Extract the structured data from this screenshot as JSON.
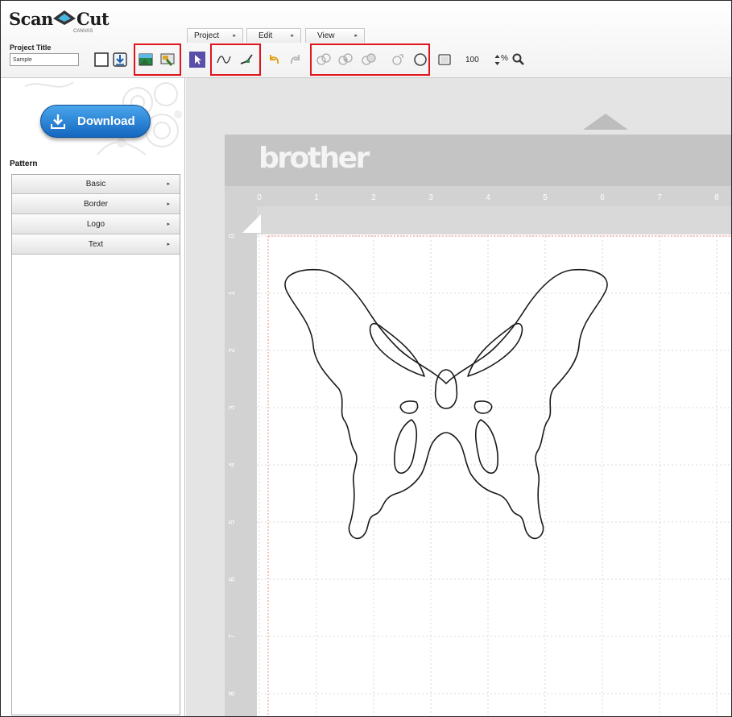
{
  "app": {
    "logo_main": "Scan",
    "logo_mid": "Cut",
    "logo_sub": "CANVAS"
  },
  "project": {
    "title_label": "Project Title",
    "title_value": "Sample"
  },
  "menus": [
    {
      "label": "Project"
    },
    {
      "label": "Edit"
    },
    {
      "label": "View"
    }
  ],
  "toolbar": {
    "zoom_value": "100",
    "zoom_unit": "%",
    "icons": [
      "new-project-icon",
      "import-icon",
      "image-trace-icon",
      "image-paint-icon",
      "select-tool-icon",
      "point-edit-icon",
      "line-draw-icon",
      "undo-icon",
      "redo-icon",
      "weld-icon",
      "intersect-icon",
      "subtract-icon",
      "exclude-icon",
      "offset-icon",
      "mat-size-icon",
      "zoom-stepper-icon",
      "magnifier-icon"
    ],
    "highlight_color": "#e0151c"
  },
  "sidebar": {
    "download_label": "Download",
    "pattern_heading": "Pattern",
    "pattern_items": [
      {
        "label": "Basic"
      },
      {
        "label": "Border"
      },
      {
        "label": "Logo"
      },
      {
        "label": "Text"
      }
    ]
  },
  "mat": {
    "brand": "brother",
    "ruler_top": [
      "0",
      "1",
      "2",
      "3",
      "4",
      "5",
      "6",
      "7",
      "8"
    ],
    "ruler_left": [
      "0",
      "1",
      "2",
      "3",
      "4",
      "5",
      "6",
      "7",
      "8"
    ],
    "shape_icon": "butterfly-shape",
    "colors": {
      "accent_blue": "#1a73cc",
      "cut_area_border": "#f08a8a",
      "brand_bar": "#c4c4c4"
    }
  }
}
